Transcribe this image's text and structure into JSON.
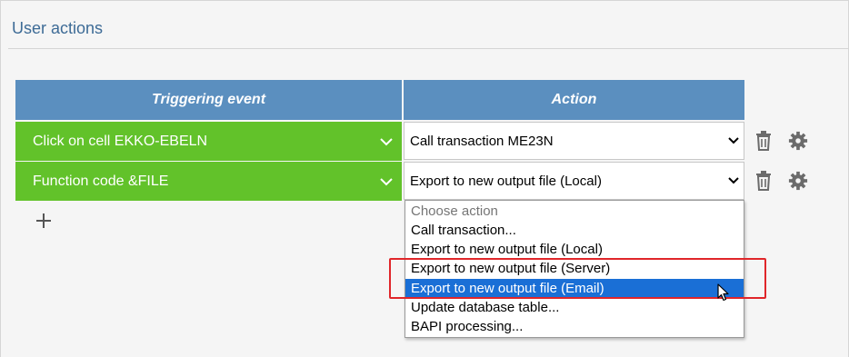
{
  "section": {
    "title": "User actions"
  },
  "table": {
    "headers": {
      "trigger": "Triggering event",
      "action": "Action"
    },
    "rows": [
      {
        "trigger": "Click on cell EKKO-EBELN",
        "action": "Call transaction ME23N"
      },
      {
        "trigger": "Function code &FILE",
        "action": "Export to new output file (Local)"
      }
    ]
  },
  "dropdown": {
    "options": [
      {
        "label": "Choose action",
        "state": "placeholder"
      },
      {
        "label": "Call transaction...",
        "state": "normal"
      },
      {
        "label": "Export to new output file (Local)",
        "state": "normal"
      },
      {
        "label": "Export to new output file (Server)",
        "state": "normal"
      },
      {
        "label": "Export to new output file (Email)",
        "state": "hovered"
      },
      {
        "label": "Update database table...",
        "state": "normal"
      },
      {
        "label": "BAPI processing...",
        "state": "normal"
      }
    ]
  },
  "icons": {
    "row_actions": [
      "trash-icon",
      "gear-icon"
    ],
    "add": "plus-icon",
    "trigger_expand": "chevron-down-icon",
    "select_arrow": "caret-down-icon",
    "pointer": "mouse-cursor"
  },
  "colors": {
    "header_bg": "#5b8fbf",
    "trigger_bg": "#62c22a",
    "title_text": "#3d6b96",
    "selected_option_bg": "#1a6fd6",
    "annotation_border": "#e0262a",
    "icon_gray": "#6b6b6b"
  }
}
